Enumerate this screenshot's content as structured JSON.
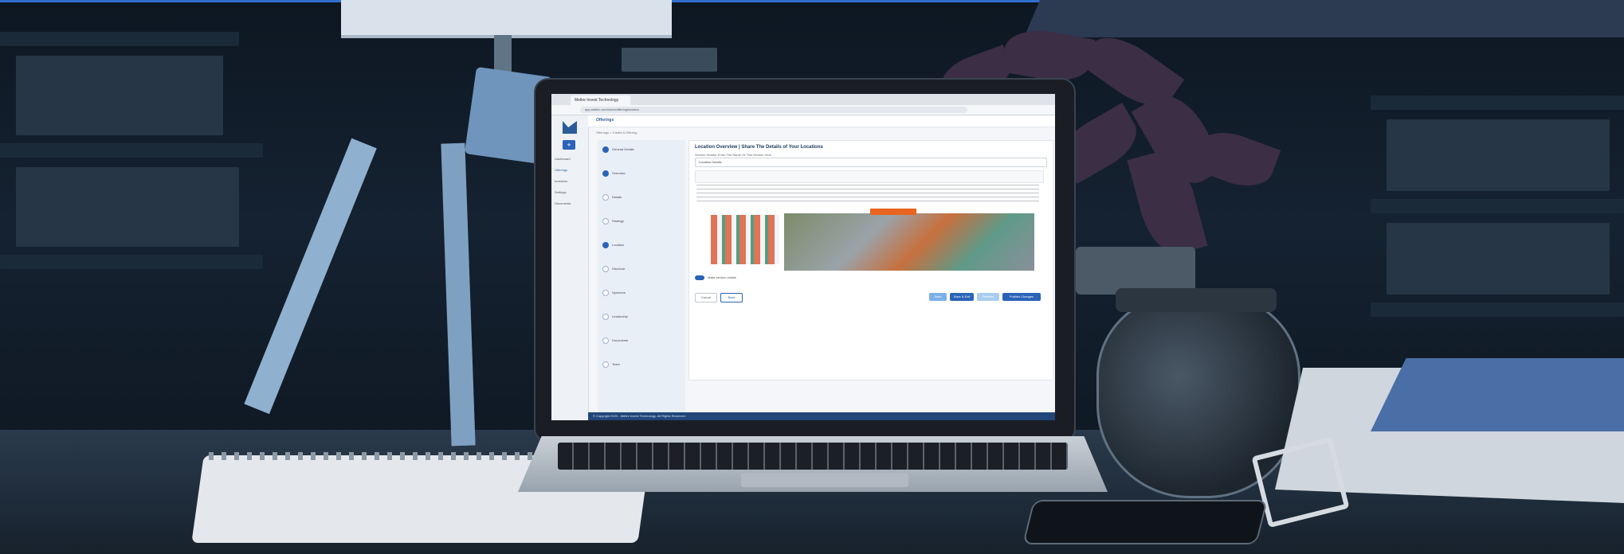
{
  "scene": {
    "description_free": true
  },
  "laptop_screen": {
    "browser_tab": "Meltre Invest Technology",
    "address": "app.meltre.com/home/offering/location",
    "brand": "Offerings",
    "breadcrumb": "Offerings  >  Create A Offering",
    "sidebar_items": [
      "Dashboard",
      "Offerings",
      "Investors",
      "Settings",
      "Documents"
    ],
    "steps": [
      "General Details",
      "Overview",
      "Details",
      "Strategy",
      "Location",
      "Structure",
      "Sponsors",
      "Leadership",
      "Documents",
      "Team"
    ],
    "page_title": "Location Overview | Share The Details of Your Locations",
    "field_label": "Section Header  Enter The Name Of This Section Here",
    "field_value": "Location Details",
    "toggle_label": "Make section visible",
    "buttons": {
      "cancel": "Cancel",
      "back": "Back",
      "save": "Save",
      "save_exit": "Save & Exit",
      "preview": "Preview",
      "publish": "Publish Changes"
    },
    "footer": "© Copyright 2023 - Meltre Invest Technology. All Rights Reserved.",
    "colors": {
      "primary": "#2a63b8",
      "accent_orange": "#e8641f",
      "footer": "#22467a"
    }
  }
}
